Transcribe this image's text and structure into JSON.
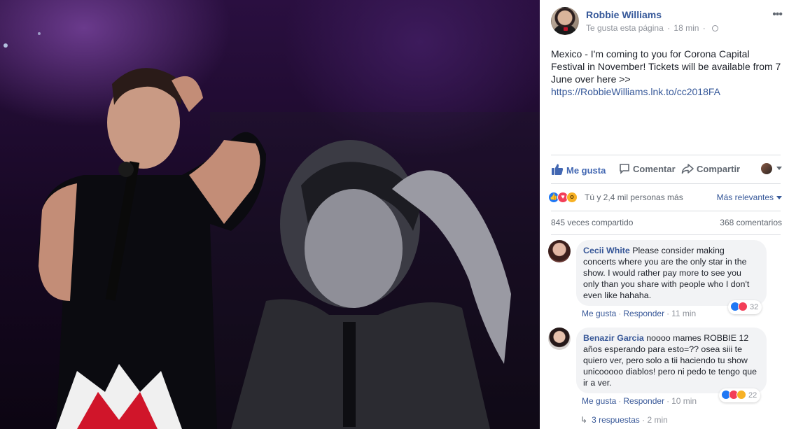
{
  "post": {
    "page_name": "Robbie Williams",
    "meta_like": "Te gusta esta página",
    "meta_time": "18 min",
    "text_main": "Mexico - I'm coming to you for Corona Capital Festival in November! Tickets will be available from 7 June over here >> ",
    "link": "https://RobbieWilliams.lnk.to/cc2018FA"
  },
  "actions": {
    "like": "Me gusta",
    "comment": "Comentar",
    "share": "Compartir"
  },
  "reactions": {
    "summary": "Tú y 2,4 mil personas más",
    "sort_label": "Más relevantes",
    "shares": "845 veces compartido",
    "comments_count": "368 comentarios"
  },
  "comments": [
    {
      "author": "Cecii White",
      "text": "Please consider making concerts where you are the only star in the show. I would rather pay more to see you only than you share with people who I don't even like hahaha.",
      "like_label": "Me gusta",
      "reply_label": "Responder",
      "time": "11 min",
      "reaction_count": "32"
    },
    {
      "author": "Benazir Garcia",
      "text": "noooo mames ROBBIE 12 años esperando para esto=?? osea siii te quiero ver, pero solo a tii haciendo tu show unicooooo diablos! pero ni pedo te tengo que ir a ver.",
      "like_label": "Me gusta",
      "reply_label": "Responder",
      "time": "10 min",
      "reaction_count": "22"
    }
  ],
  "replies": {
    "label": "3 respuestas",
    "time": "2 min"
  },
  "colors": {
    "link_blue": "#365899",
    "like_blue": "#4267b2",
    "bubble_bg": "#f2f3f5"
  }
}
